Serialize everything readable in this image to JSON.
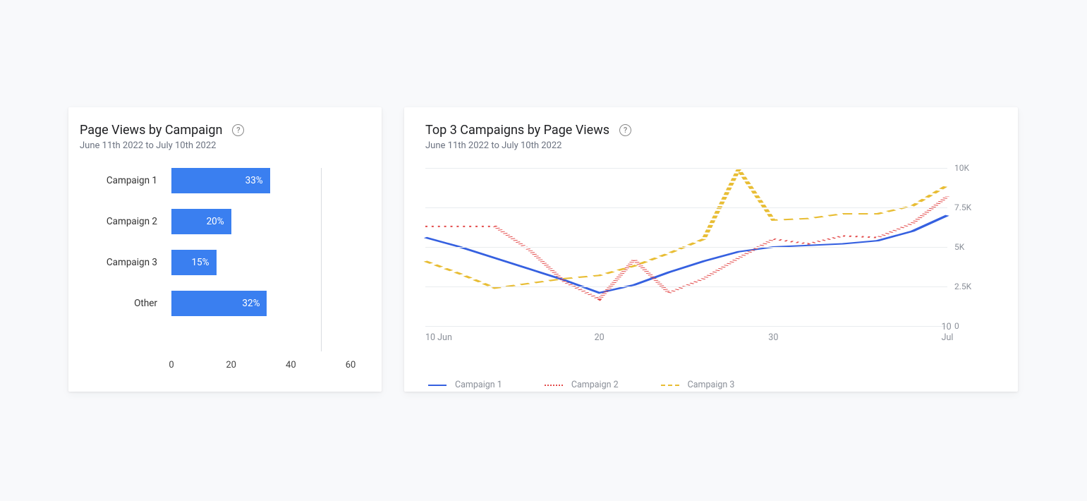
{
  "left": {
    "title": "Page Views by Campaign",
    "subtitle": "June 11th 2022 to July 10th 2022",
    "x_ticks": [
      "0",
      "20",
      "40",
      "60"
    ]
  },
  "right": {
    "title": "Top 3 Campaigns by Page Views",
    "subtitle": "June 11th 2022 to July 10th 2022",
    "y_ticks": [
      "10K",
      "7.5K",
      "5K",
      "2.5K",
      "0"
    ],
    "x_ticks": [
      "10 Jun",
      "20",
      "30",
      "10 Jul"
    ],
    "legend": [
      "Campaign 1",
      "Campaign 2",
      "Campaign 3"
    ]
  },
  "colors": {
    "bar": "#3a7ff0",
    "line1": "#3560e0",
    "line2": "#e34b4b",
    "line3": "#e8bd34"
  },
  "chart_data": [
    {
      "type": "bar",
      "title": "Page Views by Campaign",
      "subtitle": "June 11th 2022 to July 10th 2022",
      "orientation": "horizontal",
      "categories": [
        "Campaign 1",
        "Campaign 2",
        "Campaign 3",
        "Other"
      ],
      "values": [
        33,
        20,
        15,
        32
      ],
      "value_labels": [
        "33%",
        "20%",
        "15%",
        "32%"
      ],
      "xlabel": "",
      "ylabel": "",
      "xlim": [
        0,
        60
      ],
      "x_ticks": [
        0,
        20,
        40,
        60
      ]
    },
    {
      "type": "line",
      "title": "Top 3 Campaigns by Page Views",
      "subtitle": "June 11th 2022 to July 10th 2022",
      "x": [
        10,
        12,
        14,
        16,
        18,
        20,
        22,
        24,
        26,
        28,
        30,
        32,
        34,
        36,
        38,
        40
      ],
      "x_tick_labels": [
        "10 Jun",
        "20",
        "30",
        "10 Jul"
      ],
      "x_tick_positions": [
        10,
        20,
        30,
        40
      ],
      "ylim": [
        0,
        10000
      ],
      "y_ticks": [
        0,
        2500,
        5000,
        7500,
        10000
      ],
      "y_tick_labels": [
        "0",
        "2.5K",
        "5K",
        "7.5K",
        "10K"
      ],
      "legend_position": "bottom",
      "series": [
        {
          "name": "Campaign 1",
          "style": "solid",
          "color": "#3560e0",
          "values": [
            5600,
            5000,
            4300,
            3600,
            2900,
            2100,
            2600,
            3400,
            4100,
            4700,
            5000,
            5100,
            5200,
            5400,
            6000,
            7000
          ]
        },
        {
          "name": "Campaign 2",
          "style": "dotted",
          "color": "#e34b4b",
          "values": [
            6300,
            6300,
            6300,
            4800,
            2800,
            1700,
            4200,
            2100,
            3000,
            4300,
            5500,
            5200,
            5700,
            5600,
            6500,
            8200
          ]
        },
        {
          "name": "Campaign 3",
          "style": "dashed",
          "color": "#e8bd34",
          "values": [
            4100,
            3300,
            2400,
            2700,
            3000,
            3200,
            3800,
            4600,
            5500,
            9900,
            6700,
            6800,
            7100,
            7100,
            7600,
            8900
          ]
        }
      ]
    }
  ]
}
